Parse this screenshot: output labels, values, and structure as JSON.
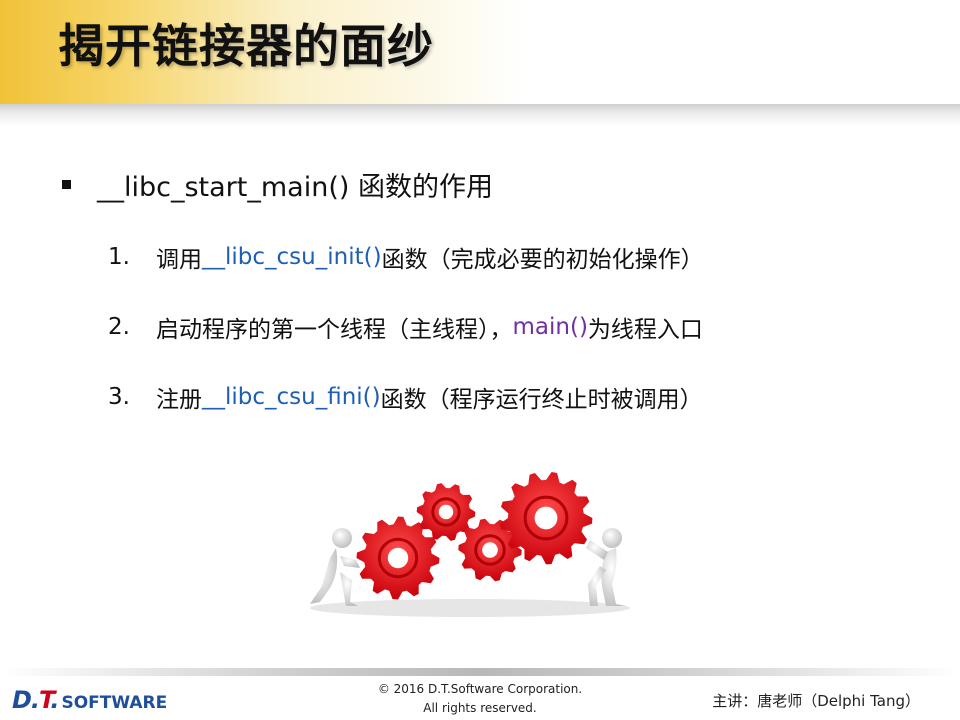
{
  "title": "揭开链接器的面纱",
  "bullet": {
    "text": "__libc_start_main() 函数的作用"
  },
  "items": [
    {
      "num": "1.",
      "pre": "调用 ",
      "func": "__libc_csu_init()",
      "post": " 函数（完成必要的初始化操作）",
      "func_color": "#1f5fb2"
    },
    {
      "num": "2.",
      "pre": "启动程序的第一个线程（主线程），",
      "func": "main()",
      "post": " 为线程入口",
      "func_color": "#7030a0"
    },
    {
      "num": "3.",
      "pre": "注册 ",
      "func": "__libc_csu_fini()",
      "post": " 函数（程序运行终止时被调用）",
      "func_color": "#1f5fb2"
    }
  ],
  "illustration": {
    "icon": "gears-with-figures-icon",
    "gear_color": "#e8141c"
  },
  "footer": {
    "logo_dt_d": "D.",
    "logo_dt_t": "T",
    "logo_dt_dot": ".",
    "logo_software": "SOFTWARE",
    "copyright_line1": "© 2016 D.T.Software Corporation.",
    "copyright_line2": "All rights reserved.",
    "presenter": "主讲：唐老师（Delphi Tang）"
  }
}
